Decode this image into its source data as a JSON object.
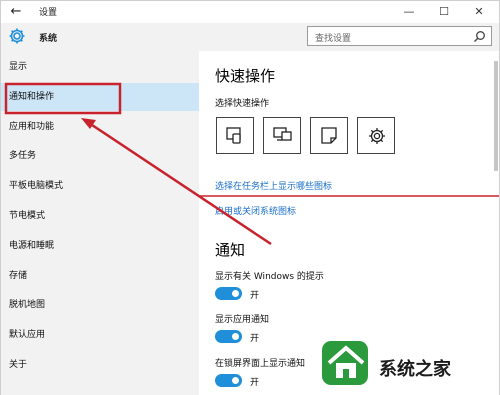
{
  "window": {
    "title": "设置",
    "back_glyph": "←",
    "minimize_glyph": "—",
    "maximize_glyph": "☐",
    "close_glyph": "✕"
  },
  "sidebar": {
    "home_label": "系统",
    "items": [
      {
        "label": "显示"
      },
      {
        "label": "通知和操作",
        "selected": true
      },
      {
        "label": "应用和功能"
      },
      {
        "label": "多任务"
      },
      {
        "label": "平板电脑模式"
      },
      {
        "label": "节电模式"
      },
      {
        "label": "电源和睡眠"
      },
      {
        "label": "存储"
      },
      {
        "label": "脱机地图"
      },
      {
        "label": "默认应用"
      },
      {
        "label": "关于"
      }
    ]
  },
  "search": {
    "placeholder": "查找设置"
  },
  "content": {
    "quick_actions": {
      "heading": "快速操作",
      "subtitle": "选择快速操作",
      "tiles": [
        "tablet-mode-icon",
        "project-icon",
        "note-icon",
        "settings-icon"
      ]
    },
    "links": {
      "taskbar_icons": "选择在任务栏上显示哪些图标",
      "system_icons": "启用或关闭系统图标"
    },
    "notifications": {
      "heading": "通知",
      "settings": [
        {
          "label": "显示有关 Windows 的提示",
          "state": "开"
        },
        {
          "label": "显示应用通知",
          "state": "开"
        },
        {
          "label": "在锁屏界面上显示通知",
          "state": "开"
        }
      ]
    }
  },
  "watermark": {
    "text": "系统之家"
  },
  "colors": {
    "accent": "#1f8fd9",
    "selection": "#cde6f7",
    "annotation_red": "#c8232c",
    "link": "#1a6fc9"
  }
}
